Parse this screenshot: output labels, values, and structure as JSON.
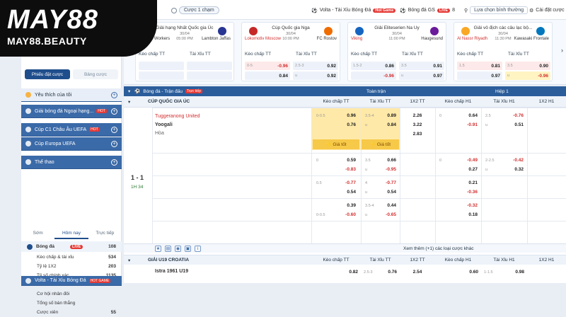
{
  "brand": {
    "name": "MAY88",
    "domain": "MAY88.BEAUTY"
  },
  "topbar": {
    "one_click": "Cược 1 chạm",
    "match_tab": "Volta - Tài Xỉu Bóng Đá",
    "hot_badge": "Hot Game",
    "gs_tab": "Bóng đá GS",
    "live_badge": "LIVE",
    "gs_count": "8",
    "sort": "Lựa chọn bình thường",
    "settings": "Cài đặt cược"
  },
  "ribbon": [
    {
      "league": "Giải hạng Nhất Quốc gia Úc",
      "date": "30/04",
      "time": "05:00 PM",
      "home": "Weston Workers",
      "away": "Lambton Jaffas",
      "home_red": false,
      "m1": "Kèo chấp TT",
      "m2": "Tài Xỉu TT",
      "r1": [
        "",
        "",
        "",
        ""
      ],
      "r2": [
        "",
        "",
        "",
        ""
      ],
      "r1hl": "",
      "r2hl": ""
    },
    {
      "league": "Cúp Quốc gia Nga",
      "date": "30/04",
      "time": "10:00 PM",
      "home": "Lokomotiv Moscow",
      "away": "FC Rostov",
      "home_red": true,
      "m1": "Kèo chấp TT",
      "m2": "Tài Xỉu TT",
      "r1": [
        "0-5",
        "-0.96",
        "",
        "0.84"
      ],
      "r2": [
        "2.5-3",
        "0.92",
        "u",
        "0.92"
      ],
      "r1hl": "red",
      "r2hl": ""
    },
    {
      "league": "Giải Eliteserien Na Uy",
      "date": "30/04",
      "time": "11:00 PM",
      "home": "Viking",
      "away": "Haugesund",
      "home_red": true,
      "m1": "Kèo chấp TT",
      "m2": "Tài Xỉu TT",
      "r1": [
        "1.5-2",
        "0.86",
        "",
        "-0.96"
      ],
      "r2": [
        "3.5",
        "0.91",
        "u",
        "0.97"
      ],
      "r1hl": "",
      "r2hl": ""
    },
    {
      "league": "Giải vô địch các câu lạc bộ...",
      "date": "30/04",
      "time": "11:30 PM",
      "home": "Al Nassr Riyadh",
      "away": "Kawasaki Frontale",
      "home_red": true,
      "m1": "Kèo chấp TT",
      "m2": "Tài Xỉu TT",
      "r1": [
        "1.5",
        "0.81",
        "",
        "0.97"
      ],
      "r2": [
        "3.5",
        "0.90",
        "u",
        "-0.96"
      ],
      "r1hl": "mix",
      "r2hl": "mix"
    }
  ],
  "sidebar": {
    "tabs": [
      "Phiếu đặt cược",
      "Bảng cược"
    ],
    "rows": [
      {
        "label": "Yêu thích của tôi",
        "style": "light",
        "hot": ""
      },
      {
        "label": "Giải bóng đá Ngoại hạng...",
        "style": "dark",
        "hot": "HOT"
      },
      {
        "label": "Cúp C1 Châu Âu UEFA",
        "style": "dark",
        "hot": "HOT"
      },
      {
        "label": "Cúp Europa UEFA",
        "style": "dark",
        "hot": ""
      },
      {
        "label": "Thể thao",
        "style": "dark",
        "hot": ""
      }
    ],
    "sport_tabs": [
      "Sớm",
      "Hôm nay",
      "Trực tiếp"
    ],
    "sport": {
      "name": "Bóng đá",
      "badge": "LIVE",
      "count": "108"
    },
    "subs": [
      {
        "label": "Kèo chấp & tài xỉu",
        "v": "534"
      },
      {
        "label": "Tỷ lệ 1X2",
        "v": "203"
      },
      {
        "label": "Tỷ số chính xác",
        "v": "1135"
      },
      {
        "label": "Lẻ/Chẵn",
        "v": "105"
      },
      {
        "label": "Cơ hội nhân đôi",
        "v": ""
      },
      {
        "label": "Tổng số bàn thắng",
        "v": ""
      },
      {
        "label": "Cược xiên",
        "v": "55"
      }
    ],
    "bottom": {
      "label": "Volta - Tài Xỉu Bóng Đá",
      "hot": "HOT GAME"
    }
  },
  "main": {
    "header": {
      "sport": "Bóng đá - Trận đấu",
      "live": "Trực tiếp",
      "full": "Toàn trận",
      "half": "Hiệp 1"
    },
    "cols": [
      "Kèo chấp TT",
      "Tài Xỉu TT",
      "1X2 TT",
      "Kèo chấp H1",
      "Tài Xỉu H1",
      "1X2 H1"
    ],
    "league1": "CÚP QUỐC GIA ÚC",
    "home": "Tuggeranong United",
    "away": "Yoogali",
    "draw": "Hòa",
    "score": "1 - 1",
    "time": "1H 34",
    "best": "Giá tốt",
    "rows": [
      {
        "h": [
          "0-0.5",
          "0.96",
          "",
          "0.76"
        ],
        "t": [
          "3.5-4",
          "0.89",
          "u",
          "0.84"
        ],
        "x": [
          "2.26",
          "3.22",
          "2.83"
        ],
        "h1": [
          "0",
          "0.64",
          "",
          "-0.91"
        ],
        "t1": [
          "2.5",
          "-0.76",
          "u",
          "0.51"
        ],
        "x1": [
          "",
          "",
          ""
        ]
      },
      {
        "h": [
          "0",
          "0.59",
          "",
          "-0.83"
        ],
        "t": [
          "3.5",
          "0.66",
          "u",
          "-0.95"
        ],
        "x": [
          "",
          "",
          ""
        ],
        "h1": [
          "0",
          "-0.49",
          "",
          "0.27"
        ],
        "t1": [
          "2-2.5",
          "-0.42",
          "u",
          "0.32"
        ],
        "x1": [
          "",
          "",
          ""
        ]
      },
      {
        "h": [
          "0.5",
          "-0.77",
          "",
          "0.54"
        ],
        "t": [
          "4",
          "-0.77",
          "u",
          "0.54"
        ],
        "x": [
          "",
          "",
          ""
        ],
        "h1": [
          "",
          "0.21",
          "",
          "-0.36"
        ],
        "t1": [
          "",
          "",
          "",
          ""
        ],
        "x1": [
          "",
          "",
          ""
        ]
      },
      {
        "h": [
          "",
          "0.39",
          "0-0.5",
          "-0.60"
        ],
        "t": [
          "3.5-4",
          "0.44",
          "u",
          "-0.65"
        ],
        "x": [
          "",
          "",
          ""
        ],
        "h1": [
          "",
          "-0.32",
          "",
          "0.18"
        ],
        "t1": [
          "",
          "",
          "",
          ""
        ],
        "x1": [
          "",
          "",
          ""
        ]
      }
    ],
    "more": "Xem thêm (+1) các loại cược khác",
    "league2": "GIẢI U19 CROATIA",
    "next_home": "Istra 1961 U19",
    "next_odds": {
      "h": "0.82",
      "t_hc": "2.5-3",
      "t": "0.76",
      "x": "2.54",
      "h1": "0.60",
      "t1_hc": "1-1.5",
      "t1": "0.98"
    }
  }
}
